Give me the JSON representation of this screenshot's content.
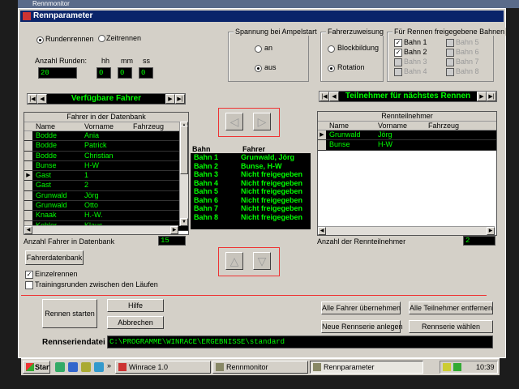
{
  "outer_title": "Rennmonitor",
  "window": {
    "title": "Rennparameter"
  },
  "race_mode": {
    "options": [
      "Rundenrennen",
      "Zeitrennen"
    ],
    "selected": "Rundenrennen",
    "laps_label": "Anzahl Runden",
    "laps_value": "20",
    "time_labels": [
      "hh",
      "mm",
      "ss"
    ],
    "time_values": [
      "0",
      "0",
      "0"
    ]
  },
  "spannung": {
    "title": "Spannung bei Ampelstart",
    "options": [
      "an",
      "aus"
    ],
    "selected": "aus"
  },
  "zuweisung": {
    "title": "Fahrerzuweisung",
    "options": [
      "Blockbildung",
      "Rotation"
    ],
    "selected": "Rotation"
  },
  "bahnen": {
    "title": "Für Rennen freigegebene Bahnen",
    "items": [
      {
        "label": "Bahn 1",
        "checked": true,
        "enabled": true
      },
      {
        "label": "Bahn 2",
        "checked": true,
        "enabled": true
      },
      {
        "label": "Bahn 3",
        "checked": false,
        "enabled": false
      },
      {
        "label": "Bahn 4",
        "checked": false,
        "enabled": false
      },
      {
        "label": "Bahn 5",
        "checked": false,
        "enabled": false
      },
      {
        "label": "Bahn 6",
        "checked": false,
        "enabled": false
      },
      {
        "label": "Bahn 7",
        "checked": false,
        "enabled": false
      },
      {
        "label": "Bahn 8",
        "checked": false,
        "enabled": false
      }
    ]
  },
  "left_nav": {
    "title": "Verfügbare Fahrer"
  },
  "right_nav": {
    "title": "Teilnehmer für nächstes Rennen"
  },
  "drivers_db": {
    "caption": "Fahrer in der Datenbank",
    "columns": [
      "Name",
      "Vorname",
      "Fahrzeug"
    ],
    "rows": [
      [
        "Bodde",
        "Ania",
        ""
      ],
      [
        "Bodde",
        "Patrick",
        ""
      ],
      [
        "Bodde",
        "Christian",
        ""
      ],
      [
        "Bunse",
        "H-W",
        ""
      ],
      [
        "Gast",
        "1",
        ""
      ],
      [
        "Gast",
        "2",
        ""
      ],
      [
        "Grunwald",
        "Jörg",
        ""
      ],
      [
        "Grunwald",
        "Otto",
        ""
      ],
      [
        "Knaak",
        "H.-W.",
        ""
      ],
      [
        "Kohler",
        "Klaus",
        ""
      ]
    ],
    "selected_row": 4,
    "count_label": "Anzahl Fahrer in Datenbank",
    "count_value": "15"
  },
  "participants": {
    "caption": "Rennteilnehmer",
    "columns": [
      "Name",
      "Vorname",
      "Fahrzeug"
    ],
    "rows": [
      [
        "Grunwald",
        "Jörg",
        ""
      ],
      [
        "Bunse",
        "H-W",
        ""
      ]
    ],
    "count_label": "Anzahl der Rennteilnehmer",
    "count_value": "2"
  },
  "assignment": {
    "headers": [
      "Bahn",
      "Fahrer"
    ],
    "rows": [
      [
        "Bahn 1",
        "Grunwald, Jörg"
      ],
      [
        "Bahn 2",
        "Bunse, H-W"
      ],
      [
        "Bahn 3",
        "Nicht freigegeben"
      ],
      [
        "Bahn 4",
        "Nicht freigegeben"
      ],
      [
        "Bahn 5",
        "Nicht freigegeben"
      ],
      [
        "Bahn 6",
        "Nicht freigegeben"
      ],
      [
        "Bahn 7",
        "Nicht freigegeben"
      ],
      [
        "Bahn 8",
        "Nicht freigegeben"
      ]
    ]
  },
  "buttons": {
    "fahrerdatenbank": "Fahrerdatenbank",
    "rennen_starten": "Rennen starten",
    "hilfe": "Hilfe",
    "abbrechen": "Abbrechen",
    "alle_uebernehmen": "Alle Fahrer übernehmen",
    "neue_rennserie": "Neue Rennserie anlegen",
    "alle_entfernen": "Alle Teilnehmer entfernen",
    "rennserie_waehlen": "Rennserie wählen"
  },
  "options": {
    "einzelrennen": {
      "label": "Einzelrennen",
      "checked": true
    },
    "training": {
      "label": "Trainingsrunden zwischen den Läufen",
      "checked": false
    }
  },
  "series_file": {
    "label": "Rennseriendatei",
    "value": "C:\\PROGRAMME\\WINRACE\\ERGEBNISSE\\standard"
  },
  "taskbar": {
    "start": "Start",
    "tasks": [
      "Winrace 1.0",
      "Rennmonitor",
      "Rennparameter"
    ],
    "active_task": "Rennparameter",
    "clock": "10:39"
  },
  "colors": {
    "lcd_fg": "#00ff00",
    "lcd_bg": "#000000",
    "title_bg": "#0a246a",
    "accent": "#ee3333"
  }
}
